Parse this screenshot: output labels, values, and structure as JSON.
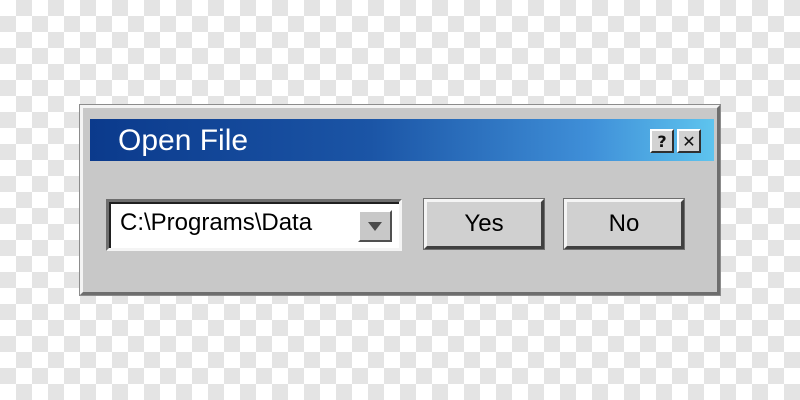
{
  "dialog": {
    "title": "Open File",
    "help_label": "?",
    "close_label": "✕"
  },
  "path_select": {
    "value": "C:\\Programs\\Data"
  },
  "buttons": {
    "yes_label": "Yes",
    "no_label": "No"
  },
  "icons": {
    "help": "help-icon",
    "close": "close-icon",
    "dropdown": "chevron-down-icon"
  },
  "colors": {
    "titlebar_start": "#0b3a8c",
    "titlebar_end": "#5ec4ee",
    "dialog_face": "#c8c8c8"
  }
}
